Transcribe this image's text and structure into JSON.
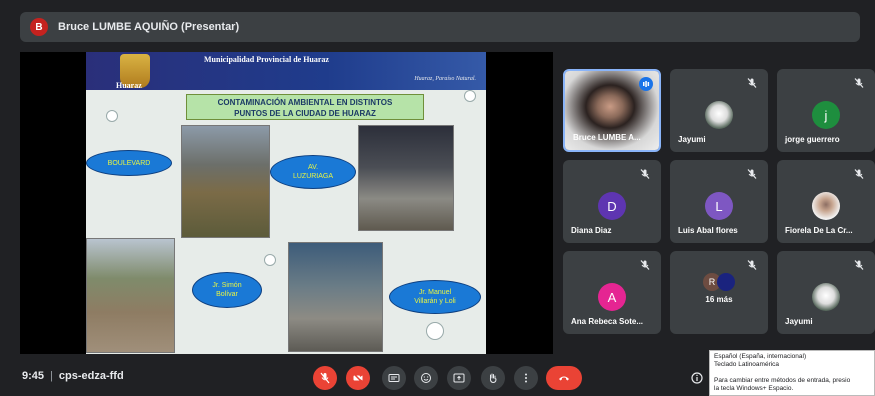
{
  "presenter": {
    "initial": "B",
    "label": "Bruce LUMBE AQUIÑO (Presentar)"
  },
  "slide": {
    "org": "Municipalidad Provincial de Huaraz",
    "tagline": "Huaraz, Paraíso Natural.",
    "logo_text": "Huaraz",
    "title_line1": "CONTAMINACIÓN AMBIENTAL EN DISTINTOS",
    "title_line2": "PUNTOS DE LA CIUDAD DE HUARAZ",
    "bubbles": {
      "boulevard": "BOULEVARD",
      "luzuriaga_1": "AV.",
      "luzuriaga_2": "LUZURIAGA",
      "bolivar_1": "Jr. Simón",
      "bolivar_2": "Bolívar",
      "villaran_1": "Jr. Manuel",
      "villaran_2": "Villarán y Loli"
    }
  },
  "participants": [
    {
      "name": "Bruce LUMBE A...",
      "type": "video",
      "active": true
    },
    {
      "name": "Jayumi",
      "type": "photo",
      "muted": true
    },
    {
      "name": "jorge guerrero",
      "type": "initial",
      "initial": "j",
      "color": "#1e8e3e",
      "muted": true
    },
    {
      "name": "Diana Diaz",
      "type": "initial",
      "initial": "D",
      "color": "#5e35b1",
      "muted": true
    },
    {
      "name": "Luis Abal flores",
      "type": "initial",
      "initial": "L",
      "color": "#7e57c2",
      "muted": true
    },
    {
      "name": "Fiorela De La Cr...",
      "type": "photo",
      "muted": true
    },
    {
      "name": "Ana Rebeca Sote...",
      "type": "initial",
      "initial": "A",
      "color": "#e52592",
      "muted": true
    },
    {
      "name": "16 más",
      "type": "more",
      "initial": "R",
      "color": "#6d4c41",
      "muted": true
    },
    {
      "name": "Jayumi",
      "type": "photo",
      "muted": true
    }
  ],
  "meeting": {
    "time": "9:45",
    "code": "cps-edza-ffd"
  },
  "tooltip": {
    "line1": "Español (España, internacional)",
    "line2": "Teclado Latinoamérica",
    "line3": "Para cambiar entre métodos de entrada, presio",
    "line4": "la tecla Windows+ Espacio."
  },
  "colors": {
    "background": "#202124",
    "tile": "#3c4043",
    "danger": "#ea4335",
    "accent": "#8ab4f8"
  },
  "icons": {
    "mic": "mic-off-icon",
    "camera": "camera-off-icon",
    "captions": "captions-icon",
    "emoji": "emoji-icon",
    "present": "present-icon",
    "hand": "raise-hand-icon",
    "more": "more-vert-icon",
    "end": "end-call-icon",
    "info": "info-icon"
  }
}
